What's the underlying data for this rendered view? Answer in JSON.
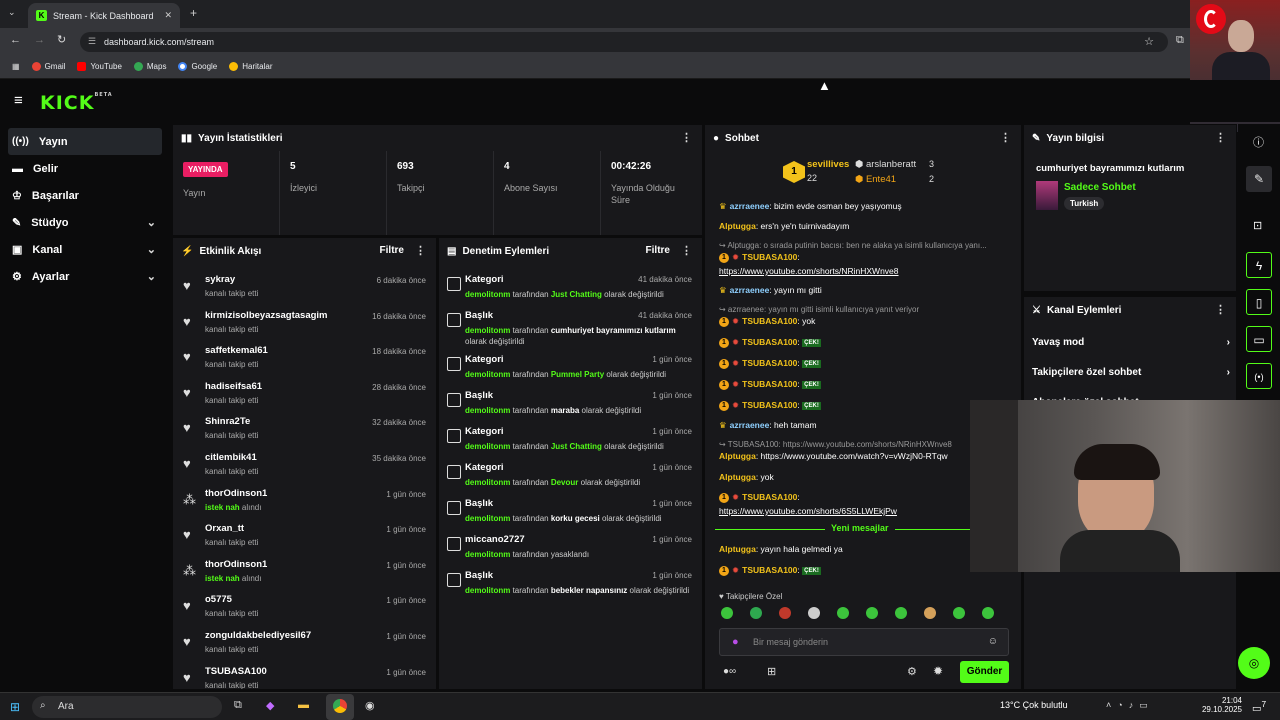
{
  "browser": {
    "tab_title": "Stream - Kick Dashboard",
    "url": "dashboard.kick.com/stream",
    "bookmarks": [
      "Gmail",
      "YouTube",
      "Maps",
      "Google",
      "Haritalar"
    ]
  },
  "app": {
    "logo": "KICK",
    "logo_sup": "BETA"
  },
  "sidebar": {
    "items": [
      {
        "label": "Yayın",
        "icon": "broadcast-icon"
      },
      {
        "label": "Gelir",
        "icon": "wallet-icon"
      },
      {
        "label": "Başarılar",
        "icon": "trophy-icon"
      },
      {
        "label": "Stüdyo",
        "icon": "studio-icon",
        "chevron": true
      },
      {
        "label": "Kanal",
        "icon": "channel-icon",
        "chevron": true
      },
      {
        "label": "Ayarlar",
        "icon": "gear-icon",
        "chevron": true
      }
    ]
  },
  "stats": {
    "title": "Yayın İstatistikleri",
    "live_badge": "YAYINDA",
    "live_label": "Yayın",
    "viewers": {
      "value": "5",
      "label": "İzleyici"
    },
    "followers": {
      "value": "693",
      "label": "Takipçi"
    },
    "subs": {
      "value": "4",
      "label": "Abone Sayısı"
    },
    "uptime": {
      "value": "00:42:26",
      "label": "Yayında Olduğu Süre"
    }
  },
  "activity": {
    "title": "Etkinlik Akışı",
    "filter": "Filtre",
    "rows": [
      {
        "name": "sykray",
        "sub": "kanalı takip etti",
        "time": "6 dakika önce",
        "type": "follow"
      },
      {
        "name": "kirmizisolbeyazsagtasagim",
        "sub": "kanalı takip etti",
        "time": "16 dakika önce",
        "type": "follow"
      },
      {
        "name": "saffetkemal61",
        "sub": "kanalı takip etti",
        "time": "18 dakika önce",
        "type": "follow"
      },
      {
        "name": "hadiseifsa61",
        "sub": "kanalı takip etti",
        "time": "28 dakika önce",
        "type": "follow"
      },
      {
        "name": "Shinra2Te",
        "sub": "kanalı takip etti",
        "time": "32 dakika önce",
        "type": "follow"
      },
      {
        "name": "citlembik41",
        "sub": "kanalı takip etti",
        "time": "35 dakika önce",
        "type": "follow"
      },
      {
        "name": "thorOdinson1",
        "sub_g": "istek nah",
        "sub": " alındı",
        "time": "1 gün önce",
        "type": "reward"
      },
      {
        "name": "Orxan_tt",
        "sub": "kanalı takip etti",
        "time": "1 gün önce",
        "type": "follow"
      },
      {
        "name": "thorOdinson1",
        "sub_g": "istek nah",
        "sub": " alındı",
        "time": "1 gün önce",
        "type": "reward"
      },
      {
        "name": "o5775",
        "sub": "kanalı takip etti",
        "time": "1 gün önce",
        "type": "follow"
      },
      {
        "name": "zonguldakbelediyesil67",
        "sub": "kanalı takip etti",
        "time": "1 gün önce",
        "type": "follow"
      },
      {
        "name": "TSUBASA100",
        "sub": "kanalı takip etti",
        "time": "1 gün önce",
        "type": "follow"
      }
    ]
  },
  "moderation": {
    "title": "Denetim Eylemleri",
    "filter": "Filtre",
    "rows": [
      {
        "title": "Kategori",
        "time": "41 dakika önce",
        "user": "demolitonm",
        "mid": " tarafından ",
        "value": "Just Chatting",
        "value_color": "g",
        "end": " olarak değiştirildi",
        "icon": "category-icon"
      },
      {
        "title": "Başlık",
        "time": "41 dakika önce",
        "user": "demolitonm",
        "mid": " tarafından ",
        "value": "cumhuriyet bayramımızı kutlarım",
        "value_color": "w",
        "end": " olarak değiştirildi",
        "icon": "title-icon"
      },
      {
        "title": "Kategori",
        "time": "1 gün önce",
        "user": "demolitonm",
        "mid": " tarafından ",
        "value": "Pummel Party",
        "value_color": "g",
        "end": " olarak değiştirildi",
        "icon": "category-icon"
      },
      {
        "title": "Başlık",
        "time": "1 gün önce",
        "user": "demolitonm",
        "mid": " tarafından ",
        "value": "maraba",
        "value_color": "w",
        "end": " olarak değiştirildi",
        "icon": "title-icon"
      },
      {
        "title": "Kategori",
        "time": "1 gün önce",
        "user": "demolitonm",
        "mid": " tarafından ",
        "value": "Just Chatting",
        "value_color": "g",
        "end": " olarak değiştirildi",
        "icon": "category-icon"
      },
      {
        "title": "Kategori",
        "time": "1 gün önce",
        "user": "demolitonm",
        "mid": " tarafından ",
        "value": "Devour",
        "value_color": "g",
        "end": " olarak değiştirildi",
        "icon": "category-icon"
      },
      {
        "title": "Başlık",
        "time": "1 gün önce",
        "user": "demolitonm",
        "mid": " tarafından ",
        "value": "korku gecesi",
        "value_color": "w",
        "end": " olarak değiştirildi",
        "icon": "title-icon"
      },
      {
        "title": "miccano2727",
        "time": "1 gün önce",
        "user": "demolitonm",
        "mid": " tarafından ",
        "value": "yasaklandı",
        "value_color": "n",
        "end": "",
        "icon": "ban-icon"
      },
      {
        "title": "Başlık",
        "time": "1 gün önce",
        "user": "demolitonm",
        "mid": " tarafından ",
        "value": "bebekler napansınız",
        "value_color": "w",
        "end": " olarak değiştirildi",
        "icon": "title-icon"
      }
    ]
  },
  "chat": {
    "title": "Sohbet",
    "leaders": [
      {
        "name": "sevillives",
        "count": "22",
        "rank": "1"
      },
      {
        "name": "arslanberatt",
        "count": "3"
      },
      {
        "name": "Ente41",
        "count": "2"
      }
    ],
    "messages": [
      {
        "user": "azrraenee",
        "text": ": bizim evde osman bey yaşıyomuş",
        "color": "bl"
      },
      {
        "user": "Alptugga",
        "text": ": ers'n ye'n tuirnivadayım",
        "color": "yl"
      },
      {
        "reply": "↪ Alptugga: o sırada putinin bacısı: ben ne alaka ya isimli kullanıcıya yanı..."
      },
      {
        "user": "TSUBASA100",
        "text": ":",
        "color": "yl",
        "coin": true
      },
      {
        "link": "https://www.youtube.com/shorts/NRinHXWnve8"
      },
      {
        "user": "azrraenee",
        "text": ": yayın mı gitti",
        "color": "bl"
      },
      {
        "reply": "↪ azrraenee: yayın mı gitti isimli kullanıcıya yanıt veriyor"
      },
      {
        "user": "TSUBASA100",
        "text": ": yok",
        "color": "yl",
        "coin": true
      },
      {
        "user": "TSUBASA100",
        "text": ":",
        "color": "yl",
        "coin": true,
        "cek": "ÇEK!"
      },
      {
        "user": "TSUBASA100",
        "text": ":",
        "color": "yl",
        "coin": true,
        "cek": "ÇEK!"
      },
      {
        "user": "TSUBASA100",
        "text": ":",
        "color": "yl",
        "coin": true,
        "cek": "ÇEK!"
      },
      {
        "user": "TSUBASA100",
        "text": ":",
        "color": "yl",
        "coin": true,
        "cek": "ÇEK!"
      },
      {
        "user": "azrraenee",
        "text": ": heh tamam",
        "color": "bl"
      },
      {
        "reply": "↪ TSUBASA100: https://www.youtube.com/shorts/NRinHXWnve8"
      },
      {
        "user": "Alptugga",
        "text": ": https://www.youtube.com/watch?v=vWzjN0-RTqw",
        "color": "yl"
      },
      {
        "user": "Alptugga",
        "text": ": yok",
        "color": "yl"
      },
      {
        "user": "TSUBASA100",
        "text": ":",
        "color": "yl",
        "coin": true
      },
      {
        "link": "https://www.youtube.com/shorts/6S5LLWEkjPw"
      }
    ],
    "new_messages": "Yeni mesajlar",
    "after": [
      {
        "user": "Alptugga",
        "text": ": yayın hala gelmedi ya",
        "color": "yl"
      },
      {
        "user": "TSUBASA100",
        "text": ":",
        "color": "yl",
        "coin": true,
        "cek": "ÇEK!"
      }
    ],
    "mode_label": "Takipçilere Özel",
    "placeholder": "Bir mesaj gönderin",
    "send": "Gönder"
  },
  "stream_info": {
    "title": "Yayın bilgisi",
    "stream_title": "cumhuriyet bayramımızı kutlarım",
    "category": "Sadece Sohbet",
    "tag": "Turkish"
  },
  "channel_actions": {
    "title": "Kanal Eylemleri",
    "items": [
      "Yavaş mod",
      "Takipçilere özel sohbet",
      "Abonelere özel sohbet"
    ]
  },
  "taskbar": {
    "search": "Ara",
    "weather": "13°C  Çok bulutlu",
    "time": "21:04",
    "date": "29.10.2025",
    "notif": "7"
  },
  "colors": {
    "brand": "#53fc18",
    "panel": "#18181b",
    "bg": "#0b0b0c",
    "live": "#e91e63"
  }
}
